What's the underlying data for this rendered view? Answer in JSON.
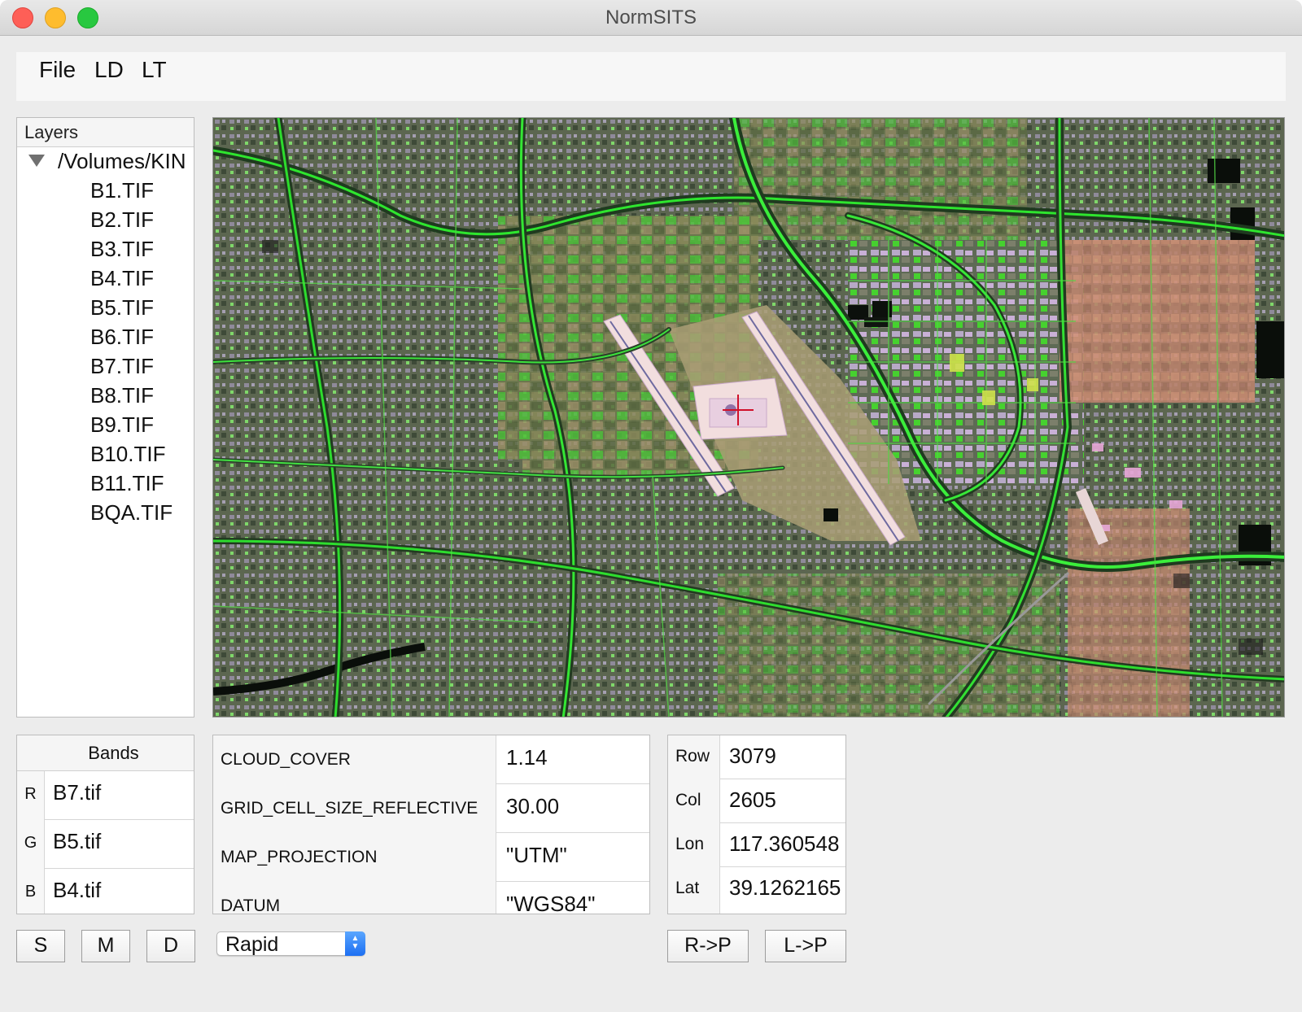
{
  "window": {
    "title": "NormSITS"
  },
  "menu": {
    "items": [
      "File",
      "LD",
      "LT"
    ]
  },
  "layers": {
    "header": "Layers",
    "root_path": "/Volumes/KIN",
    "files": [
      "B1.TIF",
      "B2.TIF",
      "B3.TIF",
      "B4.TIF",
      "B5.TIF",
      "B6.TIF",
      "B7.TIF",
      "B8.TIF",
      "B9.TIF",
      "B10.TIF",
      "B11.TIF",
      "BQA.TIF"
    ]
  },
  "bands": {
    "header": "Bands",
    "rows": [
      {
        "key": "R",
        "value": "B7.tif"
      },
      {
        "key": "G",
        "value": "B5.tif"
      },
      {
        "key": "B",
        "value": "B4.tif"
      }
    ]
  },
  "metadata": [
    {
      "key": "CLOUD_COVER",
      "value": "1.14"
    },
    {
      "key": "GRID_CELL_SIZE_REFLECTIVE",
      "value": "30.00"
    },
    {
      "key": "MAP_PROJECTION",
      "value": "\"UTM\""
    },
    {
      "key": "DATUM",
      "value": "\"WGS84\""
    }
  ],
  "coords": [
    {
      "key": "Row",
      "value": "3079"
    },
    {
      "key": "Col",
      "value": "2605"
    },
    {
      "key": "Lon",
      "value": "117.360548"
    },
    {
      "key": "Lat",
      "value": "39.1262165"
    }
  ],
  "buttons": {
    "s": "S",
    "m": "M",
    "d": "D",
    "r_to_p": "R->P",
    "l_to_p": "L->P"
  },
  "method_select": {
    "value": "Rapid"
  },
  "icons": {
    "tree_toggle": "disclosure-triangle-down-icon",
    "stepper": "up-down-stepper-icon",
    "crosshair": "crosshair-icon"
  },
  "colors": {
    "crosshair": "#d0102a",
    "vegetation": "#38e838",
    "select_accent": "#1d6ff2"
  }
}
